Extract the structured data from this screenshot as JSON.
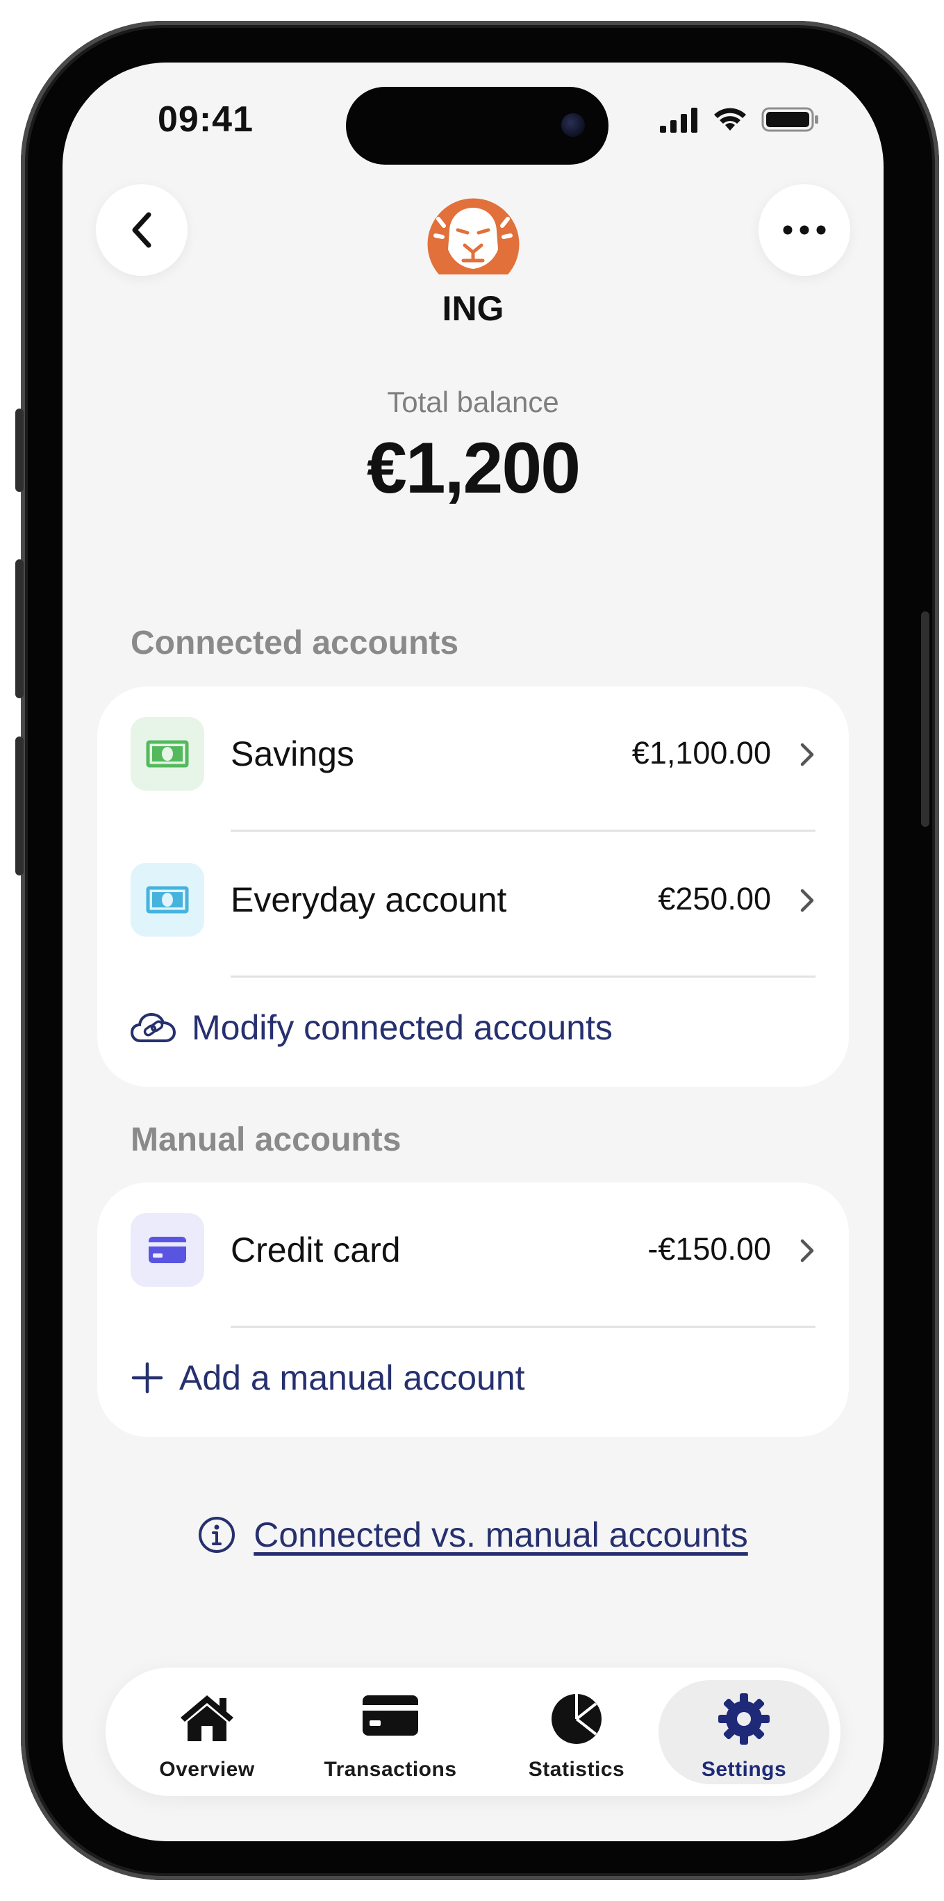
{
  "status_bar": {
    "time": "09:41"
  },
  "header": {
    "bank_name": "ING"
  },
  "balance": {
    "label": "Total balance",
    "value": "€1,200"
  },
  "connected": {
    "title": "Connected accounts",
    "accounts": [
      {
        "name": "Savings",
        "amount": "€1,100.00",
        "icon": "banknote-icon",
        "icon_bg": "#e6f5e7",
        "icon_color": "#54b95d"
      },
      {
        "name": "Everyday account",
        "amount": "€250.00",
        "icon": "banknote-icon",
        "icon_bg": "#e0f4fb",
        "icon_color": "#45b3dc"
      }
    ],
    "modify_label": "Modify connected accounts"
  },
  "manual": {
    "title": "Manual accounts",
    "accounts": [
      {
        "name": "Credit card",
        "amount": "-€150.00",
        "icon": "credit-card-icon",
        "icon_bg": "#ecebfc",
        "icon_color": "#5a55e0"
      }
    ],
    "add_label": "Add a manual account"
  },
  "info": {
    "link_label": "Connected vs. manual accounts"
  },
  "tabs": [
    {
      "label": "Overview",
      "icon": "home-icon"
    },
    {
      "label": "Transactions",
      "icon": "card-icon"
    },
    {
      "label": "Statistics",
      "icon": "pie-chart-icon"
    },
    {
      "label": "Settings",
      "icon": "gear-icon",
      "active": true
    }
  ],
  "colors": {
    "accent": "#26306f",
    "ing_orange": "#e2703a",
    "background": "#f5f5f5"
  }
}
